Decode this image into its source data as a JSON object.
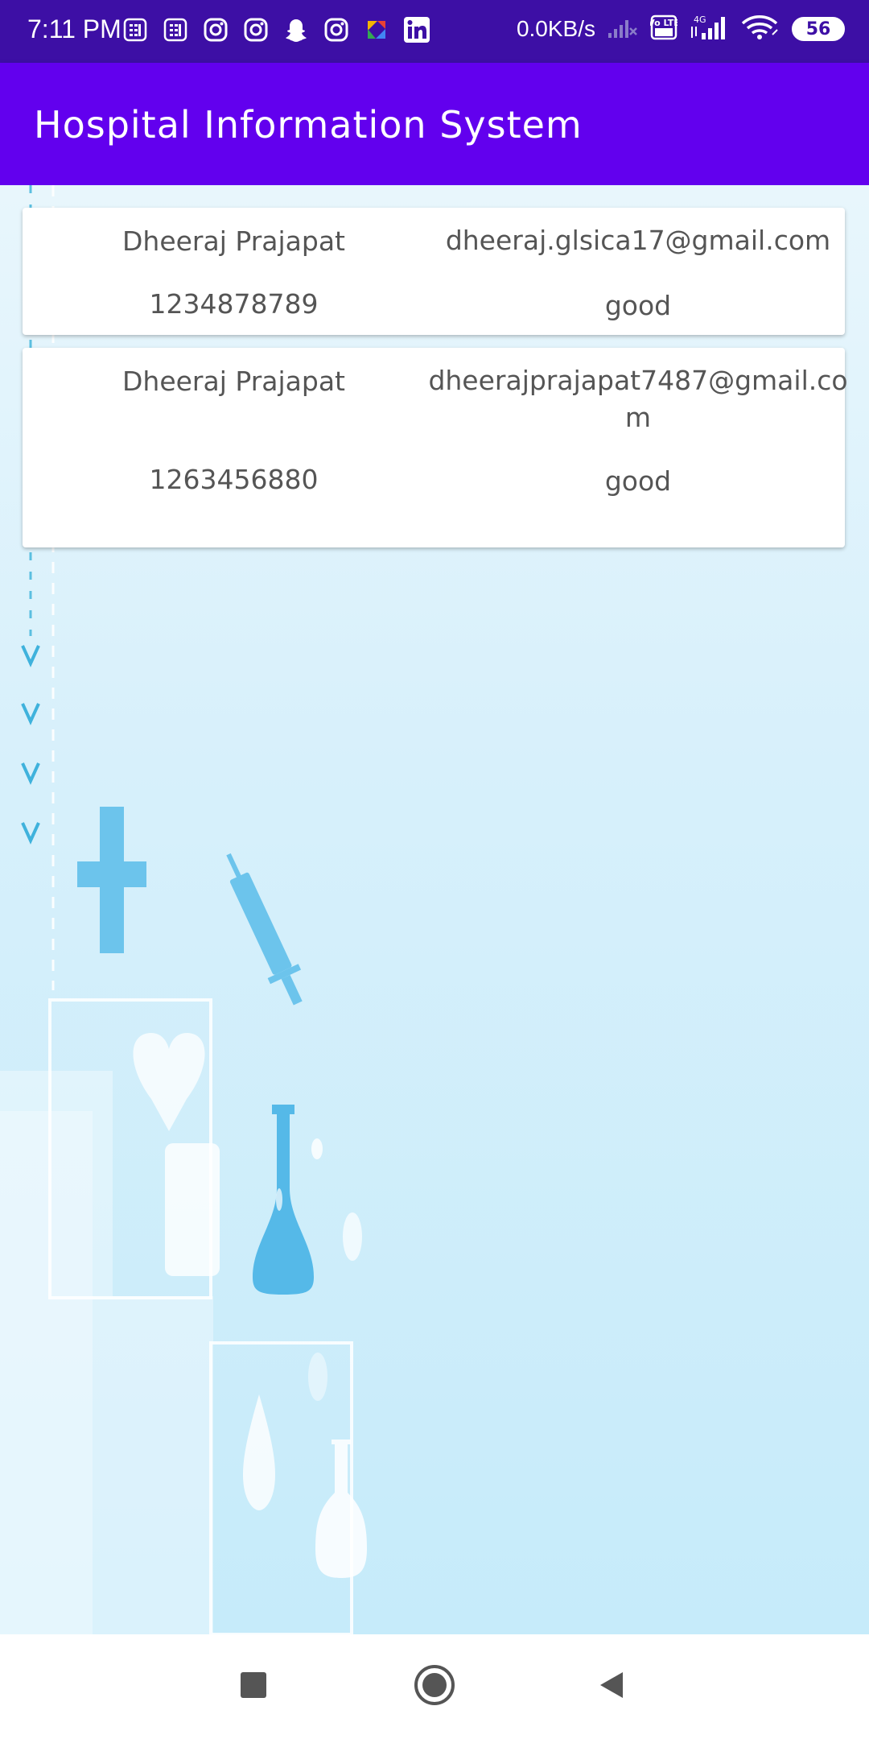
{
  "status_bar": {
    "time": "7:11 PM",
    "network_speed": "0.0KB/s",
    "battery": "56",
    "notification_icons": [
      "calculator-icon",
      "calculator-icon",
      "instagram-icon",
      "instagram-icon",
      "snapchat-icon",
      "instagram-icon",
      "photos-icon",
      "linkedin-icon"
    ],
    "right_icons": [
      "signal-off-icon",
      "volte-icon",
      "signal-4g-icon",
      "wifi-icon",
      "battery-icon"
    ],
    "network_type": "4G",
    "volte_label": "Vo LTE"
  },
  "app_bar": {
    "title": "Hospital Information System",
    "color": "#6200ee"
  },
  "records": [
    {
      "name": "Dheeraj Prajapat",
      "email": "dheeraj.glsica17@gmail.com",
      "phone": "1234878789",
      "status": "good"
    },
    {
      "name": "Dheeraj Prajapat",
      "email": "dheerajprajapat7487@gmail.com",
      "phone": "1263456880",
      "status": "good"
    }
  ],
  "nav_bar": {
    "buttons": [
      "recents-icon",
      "home-icon",
      "back-icon"
    ]
  },
  "colors": {
    "status_bar": "#3d0fa5",
    "app_bar": "#6200ee",
    "card_text": "#555555",
    "background": "#d7f0fb"
  }
}
